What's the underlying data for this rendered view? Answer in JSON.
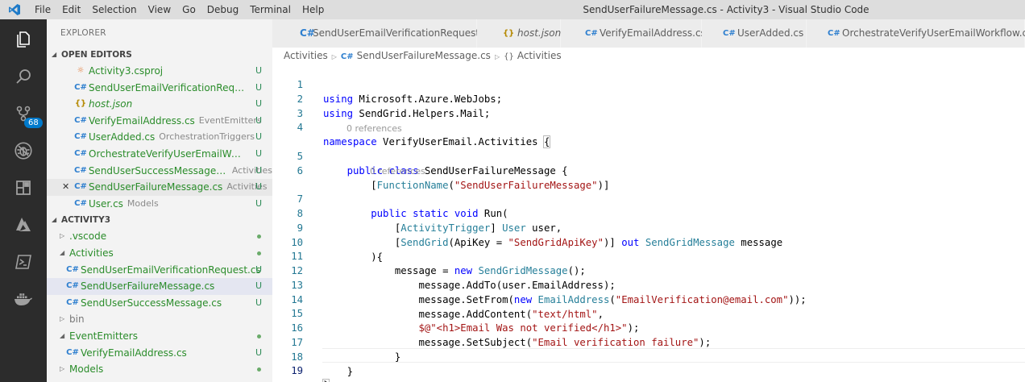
{
  "window": {
    "title": "SendUserFailureMessage.cs - Activity3 - Visual Studio Code"
  },
  "menu": [
    "File",
    "Edit",
    "Selection",
    "View",
    "Go",
    "Debug",
    "Terminal",
    "Help"
  ],
  "activity_bar": {
    "scm_badge": "68"
  },
  "sidebar": {
    "title": "EXPLORER",
    "open_editors": {
      "header": "OPEN EDITORS",
      "items": [
        {
          "name": "Activity3.csproj",
          "desc": "",
          "status": "U",
          "icon": "rss-icon"
        },
        {
          "name": "SendUserEmailVerificationRequest.c...",
          "desc": "",
          "status": "U",
          "icon": "csharp-icon"
        },
        {
          "name": "host.json",
          "desc": "",
          "status": "U",
          "icon": "json-icon"
        },
        {
          "name": "VerifyEmailAddress.cs",
          "desc": "EventEmitters",
          "status": "U",
          "icon": "csharp-icon"
        },
        {
          "name": "UserAdded.cs",
          "desc": "OrchestrationTriggers",
          "status": "U",
          "icon": "csharp-icon"
        },
        {
          "name": "OrchestrateVerifyUserEmailWorkflo...",
          "desc": "",
          "status": "U",
          "icon": "csharp-icon"
        },
        {
          "name": "SendUserSuccessMessage.cs",
          "desc": "Activities",
          "status": "U",
          "icon": "csharp-icon"
        },
        {
          "name": "SendUserFailureMessage.cs",
          "desc": "Activities",
          "status": "U",
          "icon": "csharp-icon"
        },
        {
          "name": "User.cs",
          "desc": "Models",
          "status": "U",
          "icon": "csharp-icon"
        }
      ]
    },
    "project": {
      "header": "ACTIVITY3",
      "items": [
        {
          "name": ".vscode",
          "status": "dot"
        },
        {
          "name": "Activities",
          "status": "dot"
        },
        {
          "name": "SendUserEmailVerificationRequest.cs",
          "status": "U"
        },
        {
          "name": "SendUserFailureMessage.cs",
          "status": "U"
        },
        {
          "name": "SendUserSuccessMessage.cs",
          "status": "U"
        },
        {
          "name": "bin",
          "status": ""
        },
        {
          "name": "EventEmitters",
          "status": "dot"
        },
        {
          "name": "VerifyEmailAddress.cs",
          "status": "U"
        },
        {
          "name": "Models",
          "status": "dot"
        }
      ]
    }
  },
  "tabs": [
    {
      "label": "SendUserEmailVerificationRequest.cs",
      "icon": "csharp-icon"
    },
    {
      "label": "host.json",
      "icon": "json-icon"
    },
    {
      "label": "VerifyEmailAddress.cs",
      "icon": "csharp-icon"
    },
    {
      "label": "UserAdded.cs",
      "icon": "csharp-icon"
    },
    {
      "label": "OrchestrateVerifyUserEmailWorkflow.cs",
      "icon": "csharp-icon"
    }
  ],
  "breadcrumb": {
    "root": "Activities",
    "file": "SendUserFailureMessage.cs",
    "symbol": "Activities"
  },
  "editor": {
    "codelens": "0 references",
    "line_numbers": [
      "1",
      "2",
      "3",
      "4",
      "5",
      "6",
      "7",
      "8",
      "9",
      "10",
      "11",
      "12",
      "13",
      "14",
      "15",
      "16",
      "17",
      "18",
      "19"
    ],
    "lines": [
      "using Microsoft.Azure.WebJobs;",
      "using SendGrid.Helpers.Mail;",
      "",
      "namespace VerifyUserEmail.Activities {",
      "    public class SendUserFailureMessage {",
      "        [FunctionName(\"SendUserFailureMessage\")]",
      "        public static void Run(",
      "            [ActivityTrigger] User user,",
      "            [SendGrid(ApiKey = \"SendGridApiKey\")] out SendGridMessage message",
      "        ){",
      "            message = new SendGridMessage();",
      "                message.AddTo(user.EmailAddress);",
      "                message.SetFrom(new EmailAddress(\"EmailVerification@email.com\"));",
      "                message.AddContent(\"text/html\",",
      "                $@\"<h1>Email Was not verified</h1>\");",
      "                message.SetSubject(\"Email verification failure\");",
      "            }",
      "    }",
      "}"
    ]
  },
  "colors": {
    "activity_bar": "#2c2c2c",
    "sidebar": "#f3f3f3",
    "titlebar": "#dddddd",
    "keyword": "#0000ff",
    "type": "#267f99",
    "string": "#a31515",
    "line_number": "#237893",
    "untracked": "#2a8c2a"
  }
}
